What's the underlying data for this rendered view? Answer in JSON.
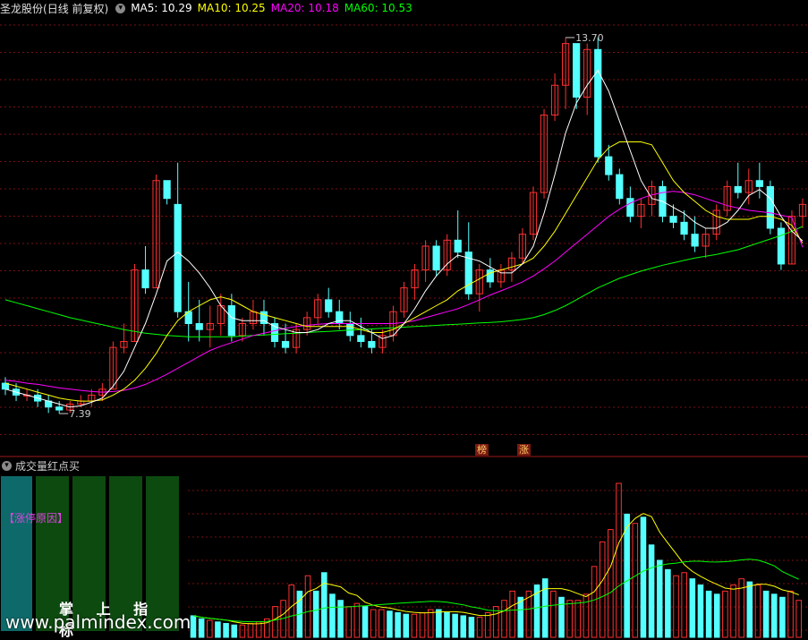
{
  "header": {
    "stock_name": "圣龙股份",
    "mode": "(日线 前复权)",
    "ma5_label": "MA5: 10.29",
    "ma10_label": "MA10: 10.25",
    "ma20_label": "MA20: 10.18",
    "ma60_label": "MA60: 10.53",
    "colors": {
      "ma5": "#ffffff",
      "ma10": "#ffff00",
      "ma20": "#ff00ff",
      "ma60": "#00ff00"
    }
  },
  "markers": {
    "high_label": "13.70",
    "low_label": "7.39",
    "bang": "榜",
    "zhang": "涨"
  },
  "lower": {
    "indicator_title": "成交量红点买",
    "reason_label": "【涨停原因】",
    "slogan": "掌 上 指 标",
    "watermark": "www.palmindex.com"
  },
  "chart_data": {
    "type": "candlestick",
    "title": "圣龙股份 (日线 前复权)",
    "ylim": [
      7.0,
      14.0
    ],
    "up_color": "#ff3030",
    "down_color": "#54ffff",
    "high": 13.7,
    "low": 7.39,
    "ohlc": [
      [
        7.9,
        8.0,
        7.7,
        7.8
      ],
      [
        7.8,
        7.9,
        7.6,
        7.7
      ],
      [
        7.7,
        7.8,
        7.6,
        7.7
      ],
      [
        7.7,
        7.8,
        7.5,
        7.6
      ],
      [
        7.6,
        7.7,
        7.4,
        7.5
      ],
      [
        7.5,
        7.6,
        7.39,
        7.45
      ],
      [
        7.45,
        7.6,
        7.4,
        7.55
      ],
      [
        7.55,
        7.7,
        7.5,
        7.6
      ],
      [
        7.6,
        7.8,
        7.5,
        7.7
      ],
      [
        7.7,
        7.9,
        7.6,
        7.8
      ],
      [
        7.8,
        8.6,
        7.8,
        8.5
      ],
      [
        8.5,
        8.9,
        8.4,
        8.6
      ],
      [
        8.6,
        9.9,
        8.6,
        9.8
      ],
      [
        9.8,
        10.2,
        9.4,
        9.5
      ],
      [
        9.5,
        11.4,
        9.5,
        11.3
      ],
      [
        11.3,
        11.2,
        10.9,
        11.0
      ],
      [
        10.9,
        11.6,
        9.0,
        9.1
      ],
      [
        9.1,
        9.6,
        8.6,
        8.9
      ],
      [
        8.9,
        9.3,
        8.6,
        8.8
      ],
      [
        8.8,
        9.2,
        8.5,
        8.9
      ],
      [
        8.9,
        9.4,
        8.7,
        9.2
      ],
      [
        9.2,
        9.4,
        8.6,
        8.7
      ],
      [
        8.7,
        9.0,
        8.6,
        8.9
      ],
      [
        8.9,
        9.3,
        8.8,
        9.1
      ],
      [
        9.1,
        9.3,
        8.7,
        8.9
      ],
      [
        8.9,
        9.0,
        8.5,
        8.6
      ],
      [
        8.6,
        8.9,
        8.4,
        8.5
      ],
      [
        8.5,
        8.9,
        8.4,
        8.8
      ],
      [
        8.8,
        9.1,
        8.7,
        9.0
      ],
      [
        9.0,
        9.4,
        8.9,
        9.3
      ],
      [
        9.3,
        9.5,
        9.0,
        9.1
      ],
      [
        9.1,
        9.3,
        8.8,
        8.9
      ],
      [
        8.9,
        9.1,
        8.6,
        8.7
      ],
      [
        8.7,
        9.0,
        8.5,
        8.6
      ],
      [
        8.6,
        8.8,
        8.4,
        8.5
      ],
      [
        8.5,
        8.8,
        8.4,
        8.7
      ],
      [
        8.7,
        9.2,
        8.6,
        9.1
      ],
      [
        9.1,
        9.6,
        9.0,
        9.5
      ],
      [
        9.5,
        9.9,
        9.3,
        9.8
      ],
      [
        9.8,
        10.3,
        9.6,
        10.2
      ],
      [
        10.2,
        10.3,
        9.7,
        9.8
      ],
      [
        9.8,
        10.4,
        9.7,
        10.3
      ],
      [
        10.3,
        10.8,
        10.0,
        10.1
      ],
      [
        10.1,
        10.6,
        9.3,
        9.4
      ],
      [
        9.4,
        9.9,
        9.1,
        9.8
      ],
      [
        9.8,
        10.0,
        9.5,
        9.6
      ],
      [
        9.6,
        9.9,
        9.5,
        9.8
      ],
      [
        9.8,
        10.1,
        9.6,
        10.0
      ],
      [
        10.0,
        10.5,
        9.9,
        10.4
      ],
      [
        10.4,
        11.2,
        10.3,
        11.1
      ],
      [
        11.1,
        12.5,
        11.0,
        12.4
      ],
      [
        12.4,
        13.1,
        12.3,
        12.9
      ],
      [
        12.9,
        13.7,
        12.5,
        13.6
      ],
      [
        13.6,
        13.4,
        12.5,
        12.7
      ],
      [
        12.7,
        13.6,
        12.4,
        13.5
      ],
      [
        13.5,
        13.7,
        11.6,
        11.7
      ],
      [
        11.7,
        11.9,
        11.3,
        11.4
      ],
      [
        11.4,
        11.5,
        10.9,
        11.0
      ],
      [
        11.0,
        11.2,
        10.6,
        10.7
      ],
      [
        10.7,
        11.0,
        10.5,
        10.9
      ],
      [
        10.9,
        11.3,
        10.7,
        11.2
      ],
      [
        11.2,
        11.3,
        10.6,
        10.7
      ],
      [
        10.7,
        10.9,
        10.5,
        10.6
      ],
      [
        10.6,
        10.8,
        10.3,
        10.4
      ],
      [
        10.4,
        10.7,
        10.1,
        10.2
      ],
      [
        10.2,
        10.5,
        10.0,
        10.4
      ],
      [
        10.4,
        10.9,
        10.3,
        10.8
      ],
      [
        10.8,
        11.3,
        10.7,
        11.2
      ],
      [
        11.2,
        11.6,
        11.0,
        11.1
      ],
      [
        11.1,
        11.5,
        10.9,
        11.3
      ],
      [
        11.3,
        11.6,
        11.0,
        11.2
      ],
      [
        11.2,
        11.3,
        10.4,
        10.5
      ],
      [
        10.5,
        10.6,
        9.8,
        9.9
      ],
      [
        9.9,
        10.8,
        9.9,
        10.7
      ],
      [
        10.7,
        11.0,
        10.5,
        10.9
      ]
    ],
    "ma5": [
      7.8,
      7.75,
      7.7,
      7.65,
      7.6,
      7.55,
      7.5,
      7.52,
      7.58,
      7.65,
      7.85,
      8.1,
      8.5,
      8.9,
      9.4,
      9.95,
      10.1,
      9.95,
      9.75,
      9.5,
      9.2,
      9.0,
      8.95,
      8.95,
      8.95,
      8.85,
      8.8,
      8.75,
      8.75,
      8.8,
      8.9,
      8.95,
      8.95,
      8.85,
      8.75,
      8.65,
      8.7,
      8.9,
      9.15,
      9.45,
      9.7,
      9.9,
      10.05,
      10.0,
      9.95,
      9.85,
      9.75,
      9.75,
      9.9,
      10.2,
      10.75,
      11.4,
      12.1,
      12.6,
      12.9,
      13.15,
      12.8,
      12.3,
      11.8,
      11.3,
      11.0,
      10.95,
      10.85,
      10.75,
      10.6,
      10.5,
      10.5,
      10.6,
      10.8,
      11.05,
      11.15,
      11.0,
      10.7,
      10.45,
      10.29
    ],
    "ma10": [
      7.9,
      7.85,
      7.8,
      7.75,
      7.7,
      7.65,
      7.62,
      7.6,
      7.6,
      7.62,
      7.7,
      7.8,
      7.95,
      8.15,
      8.4,
      8.7,
      8.95,
      9.1,
      9.2,
      9.3,
      9.35,
      9.3,
      9.2,
      9.1,
      9.05,
      9.0,
      8.95,
      8.9,
      8.85,
      8.85,
      8.85,
      8.85,
      8.85,
      8.8,
      8.75,
      8.75,
      8.8,
      8.9,
      9.0,
      9.1,
      9.2,
      9.3,
      9.45,
      9.55,
      9.65,
      9.75,
      9.8,
      9.85,
      9.9,
      10.0,
      10.2,
      10.45,
      10.75,
      11.05,
      11.35,
      11.65,
      11.85,
      11.95,
      11.95,
      11.95,
      11.9,
      11.6,
      11.3,
      11.1,
      10.95,
      10.8,
      10.7,
      10.65,
      10.65,
      10.65,
      10.7,
      10.7,
      10.65,
      10.55,
      10.25
    ],
    "ma20": [
      7.95,
      7.93,
      7.9,
      7.88,
      7.85,
      7.82,
      7.8,
      7.78,
      7.76,
      7.75,
      7.76,
      7.78,
      7.82,
      7.88,
      7.96,
      8.05,
      8.15,
      8.25,
      8.35,
      8.45,
      8.52,
      8.58,
      8.64,
      8.7,
      8.74,
      8.78,
      8.82,
      8.85,
      8.87,
      8.89,
      8.9,
      8.9,
      8.9,
      8.9,
      8.9,
      8.9,
      8.9,
      8.92,
      8.95,
      9.0,
      9.05,
      9.1,
      9.15,
      9.22,
      9.3,
      9.38,
      9.45,
      9.52,
      9.6,
      9.7,
      9.82,
      9.95,
      10.1,
      10.25,
      10.4,
      10.55,
      10.7,
      10.82,
      10.92,
      11.0,
      11.06,
      11.1,
      11.12,
      11.1,
      11.06,
      11.0,
      10.94,
      10.88,
      10.84,
      10.8,
      10.78,
      10.76,
      10.72,
      10.68,
      10.18
    ],
    "ma60": [
      9.3,
      9.25,
      9.2,
      9.15,
      9.1,
      9.05,
      9.0,
      8.96,
      8.92,
      8.88,
      8.84,
      8.8,
      8.77,
      8.74,
      8.72,
      8.7,
      8.69,
      8.68,
      8.68,
      8.68,
      8.68,
      8.68,
      8.69,
      8.7,
      8.71,
      8.72,
      8.73,
      8.74,
      8.75,
      8.76,
      8.77,
      8.78,
      8.79,
      8.8,
      8.81,
      8.82,
      8.83,
      8.84,
      8.85,
      8.86,
      8.87,
      8.88,
      8.89,
      8.9,
      8.91,
      8.92,
      8.93,
      8.95,
      8.97,
      9.0,
      9.05,
      9.12,
      9.2,
      9.3,
      9.4,
      9.5,
      9.58,
      9.66,
      9.72,
      9.78,
      9.83,
      9.88,
      9.92,
      9.96,
      10.0,
      10.03,
      10.06,
      10.1,
      10.14,
      10.2,
      10.26,
      10.32,
      10.38,
      10.45,
      10.53
    ],
    "volume": [
      14,
      12,
      11,
      10,
      9,
      8,
      8,
      9,
      10,
      12,
      20,
      24,
      34,
      30,
      40,
      30,
      42,
      28,
      24,
      20,
      22,
      20,
      18,
      18,
      17,
      16,
      15,
      15,
      16,
      18,
      18,
      16,
      15,
      14,
      13,
      13,
      16,
      20,
      24,
      30,
      26,
      30,
      34,
      38,
      30,
      26,
      24,
      24,
      28,
      46,
      62,
      70,
      100,
      80,
      74,
      78,
      60,
      50,
      44,
      40,
      42,
      38,
      34,
      30,
      28,
      30,
      34,
      38,
      36,
      34,
      30,
      28,
      26,
      30,
      24
    ]
  }
}
